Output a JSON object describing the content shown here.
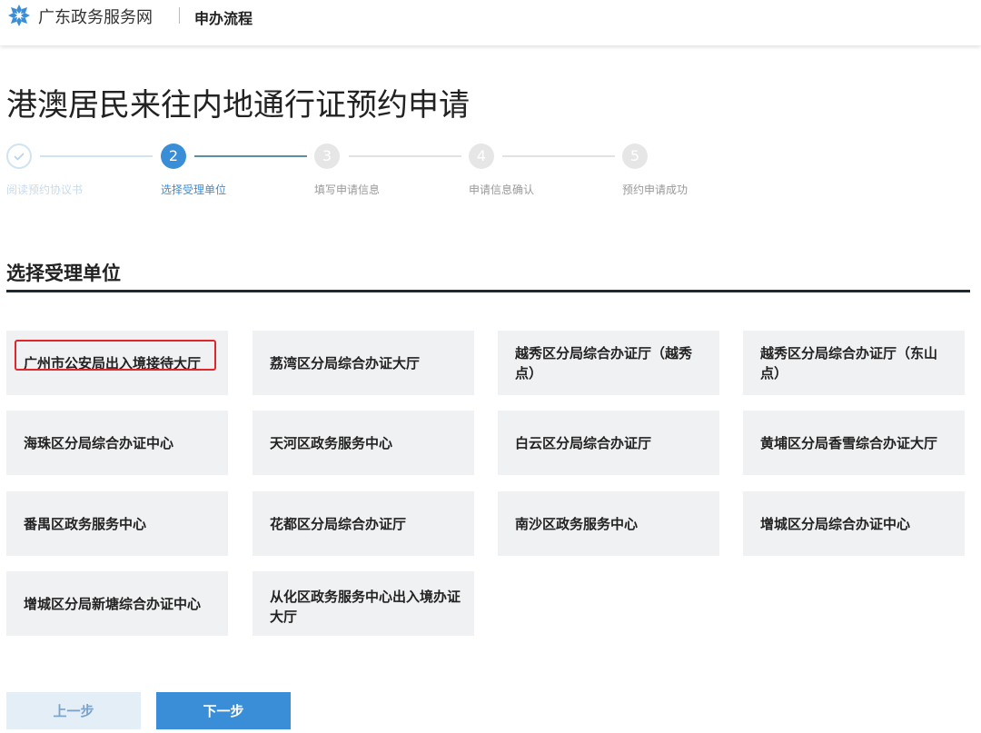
{
  "header": {
    "site_name": "广东政务服务网",
    "flow_label": "申办流程",
    "logo_icon": "snowflake-logo-icon",
    "logo_color": "#3a8ed8"
  },
  "page_title": "港澳居民来往内地通行证预约申请",
  "stepper": {
    "current": 2,
    "steps": [
      {
        "number": "1",
        "label": "阅读预约协议书",
        "state": "done",
        "icon": "check-icon"
      },
      {
        "number": "2",
        "label": "选择受理单位",
        "state": "active"
      },
      {
        "number": "3",
        "label": "填写申请信息",
        "state": "todo"
      },
      {
        "number": "4",
        "label": "申请信息确认",
        "state": "todo"
      },
      {
        "number": "5",
        "label": "预约申请成功",
        "state": "todo"
      }
    ]
  },
  "section_title": "选择受理单位",
  "offices": [
    {
      "label": "广州市公安局出入境接待大厅",
      "selected": true
    },
    {
      "label": "荔湾区分局综合办证大厅"
    },
    {
      "label": "越秀区分局综合办证厅（越秀点）"
    },
    {
      "label": "越秀区分局综合办证厅（东山点）"
    },
    {
      "label": "海珠区分局综合办证中心"
    },
    {
      "label": "天河区政务服务中心"
    },
    {
      "label": "白云区分局综合办证厅"
    },
    {
      "label": "黄埔区分局香雪综合办证大厅"
    },
    {
      "label": "番禺区政务服务中心"
    },
    {
      "label": "花都区分局综合办证厅"
    },
    {
      "label": "南沙区政务服务中心"
    },
    {
      "label": "增城区分局综合办证中心"
    },
    {
      "label": "增城区分局新塘综合办证中心"
    },
    {
      "label": "从化区政务服务中心出入境办证大厅"
    }
  ],
  "buttons": {
    "prev_label": "上一步",
    "next_label": "下一步"
  },
  "colors": {
    "accent": "#3a8ed8",
    "highlight": "#e0262a",
    "tile_bg": "#f0f1f2"
  }
}
